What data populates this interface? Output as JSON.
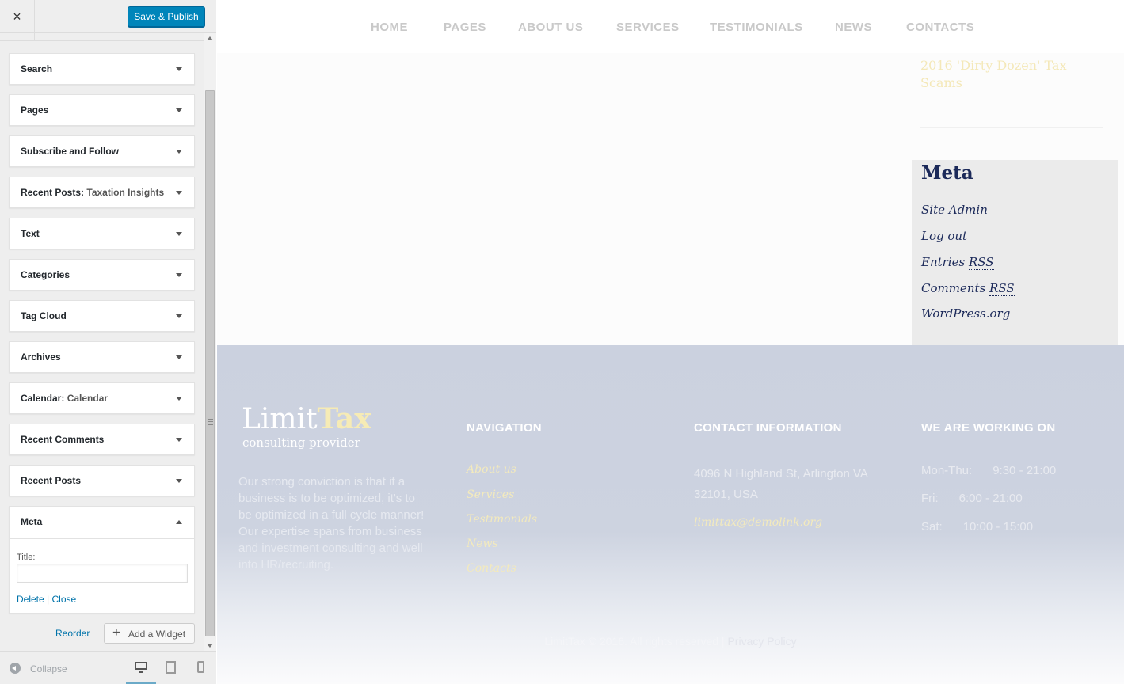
{
  "customizer": {
    "close_icon": "×",
    "save_label": "Save & Publish",
    "widgets": [
      {
        "title": "Search",
        "subtitle": ""
      },
      {
        "title": "Pages",
        "subtitle": ""
      },
      {
        "title": "Subscribe and Follow",
        "subtitle": ""
      },
      {
        "title": "Recent Posts:",
        "subtitle": "Taxation Insights"
      },
      {
        "title": "Text",
        "subtitle": ""
      },
      {
        "title": "Categories",
        "subtitle": ""
      },
      {
        "title": "Tag Cloud",
        "subtitle": ""
      },
      {
        "title": "Archives",
        "subtitle": ""
      },
      {
        "title": "Calendar:",
        "subtitle": "Calendar"
      },
      {
        "title": "Recent Comments",
        "subtitle": ""
      },
      {
        "title": "Recent Posts",
        "subtitle": ""
      }
    ],
    "meta_widget": {
      "title": "Meta",
      "title_label": "Title:",
      "title_value": "",
      "delete_label": "Delete",
      "separator": "|",
      "close_label": "Close"
    },
    "reorder_label": "Reorder",
    "add_widget_label": "Add a Widget",
    "add_widget_icon": "+",
    "collapse_label": "Collapse"
  },
  "site": {
    "nav": [
      "HOME",
      "PAGES",
      "ABOUT US",
      "SERVICES",
      "TESTIMONIALS",
      "NEWS",
      "CONTACTS"
    ],
    "faded_post_title": "2016 'Dirty Dozen' Tax Scams",
    "meta": {
      "heading": "Meta",
      "site_admin": "Site Admin",
      "log_out": "Log out",
      "entries": "Entries",
      "comments": "Comments",
      "rss": "RSS",
      "wordpress": "WordPress.org"
    },
    "footer": {
      "logo_limit": "Limit",
      "logo_tax": "Tax",
      "logo_sub": "consulting provider",
      "about": "Our strong conviction is that if a business is to be optimized, it's to be optimized in a full cycle manner! Our expertise spans from business and investment consulting and well into HR/recruiting.",
      "nav_heading": "NAVIGATION",
      "nav_links": [
        "About us",
        "Services",
        "Testimonials",
        "News",
        "Contacts"
      ],
      "contact_heading": "CONTACT INFORMATION",
      "address": "4096 N Highland St, Arlington VA 32101, USA",
      "email": "limittax@demolink.org",
      "hours_heading": "WE ARE WORKING ON",
      "hours": [
        {
          "day": "Mon-Thu:",
          "time": "9:30 - 21:00"
        },
        {
          "day": "Fri:",
          "time": "6:00 - 21:00"
        },
        {
          "day": "Sat:",
          "time": "10:00 - 15:00"
        }
      ],
      "copyright": "LimitTax © 2016. All rights reserved |",
      "privacy": "Privacy Policy"
    }
  },
  "colors": {
    "accent": "#0085ba",
    "meta_text": "#1c2a5a",
    "footer_bg": "#cbd1df",
    "logo_accent": "#f6ebb5"
  }
}
